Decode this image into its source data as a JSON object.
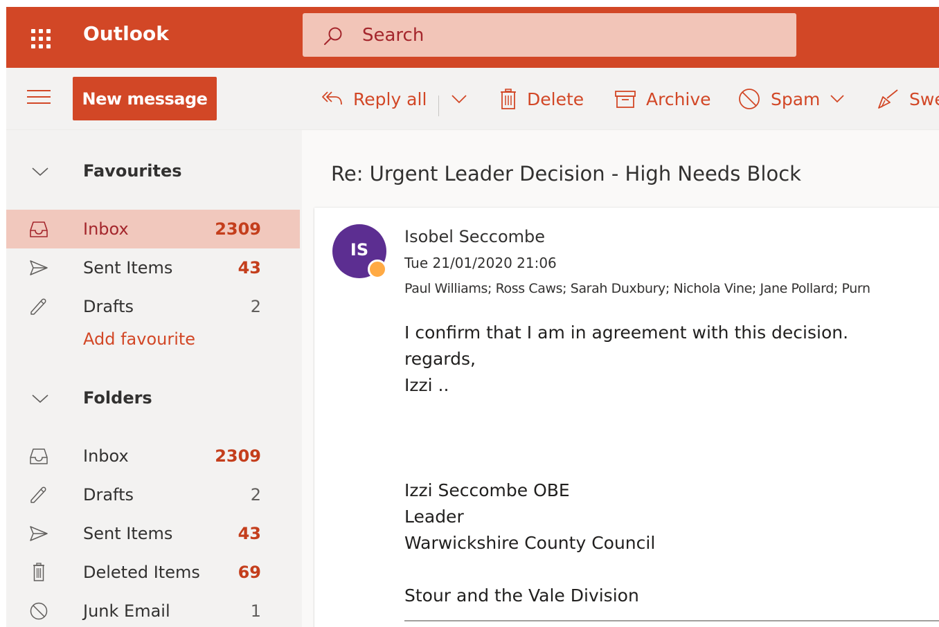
{
  "app": {
    "title": "Outlook",
    "accent_color": "#d24726"
  },
  "search": {
    "placeholder": "Search"
  },
  "toolbar": {
    "new_message_label": "New message",
    "reply_all_label": "Reply all",
    "delete_label": "Delete",
    "archive_label": "Archive",
    "spam_label": "Spam",
    "sweep_label": "Swe"
  },
  "nav": {
    "favourites": {
      "header": "Favourites",
      "items": [
        {
          "name": "Inbox",
          "count": "2309",
          "icon": "inbox-icon"
        },
        {
          "name": "Sent Items",
          "count": "43",
          "icon": "send-icon"
        },
        {
          "name": "Drafts",
          "count": "2",
          "icon": "pencil-icon"
        }
      ],
      "add_label": "Add favourite"
    },
    "folders": {
      "header": "Folders",
      "items": [
        {
          "name": "Inbox",
          "count": "2309",
          "icon": "inbox-icon"
        },
        {
          "name": "Drafts",
          "count": "2",
          "icon": "pencil-icon"
        },
        {
          "name": "Sent Items",
          "count": "43",
          "icon": "send-icon"
        },
        {
          "name": "Deleted Items",
          "count": "69",
          "icon": "trash-icon"
        },
        {
          "name": "Junk Email",
          "count": "1",
          "icon": "block-icon"
        }
      ]
    }
  },
  "message": {
    "subject": "Re: Urgent Leader Decision - High Needs Block",
    "avatar_initials": "IS",
    "avatar_color": "#5c2e91",
    "sender": "Isobel Seccombe",
    "sent": "Tue 21/01/2020 21:06",
    "to": "Paul Williams; Ross Caws; Sarah Duxbury; Nichola Vine; Jane Pollard; Purn",
    "body": {
      "line1": "I confirm that I am in agreement with this decision.",
      "line2": "regards,",
      "line3": "Izzi ..",
      "sig1": "Izzi Seccombe OBE",
      "sig2": "Leader",
      "sig3": "Warwickshire County Council",
      "sig4": "Stour and the Vale Division"
    }
  }
}
